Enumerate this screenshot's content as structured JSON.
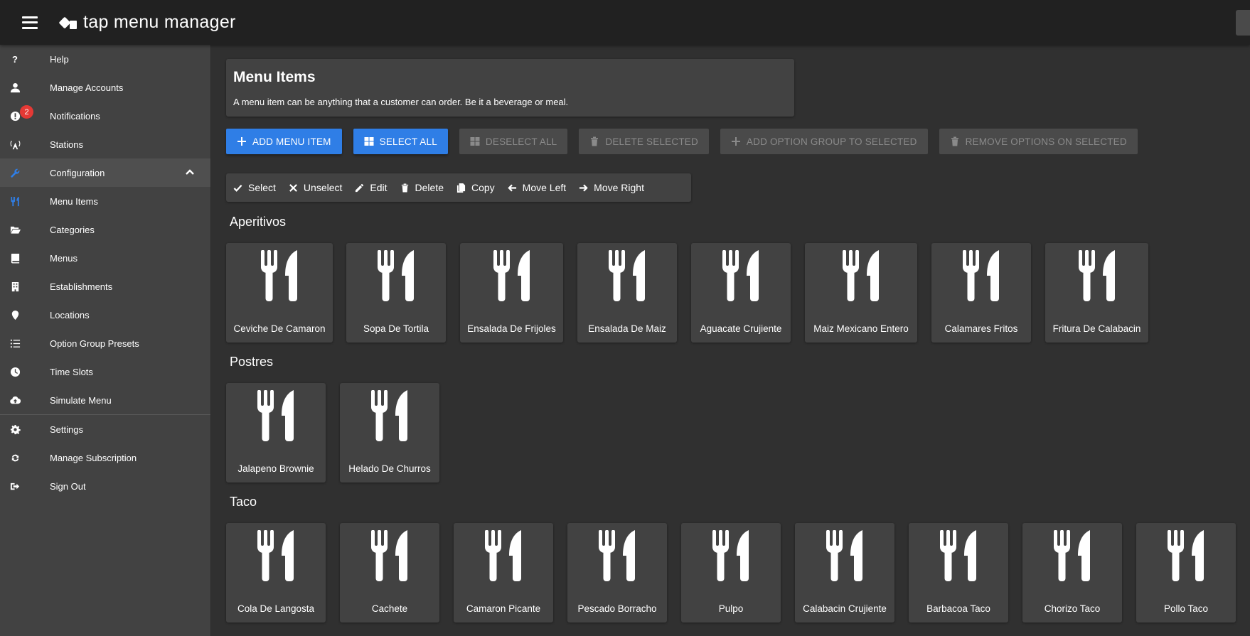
{
  "app": {
    "title": "tap menu manager"
  },
  "sidebar": {
    "notifications_badge": "2",
    "items": [
      {
        "label": "Help",
        "icon": "help-icon"
      },
      {
        "label": "Manage Accounts",
        "icon": "person-icon"
      },
      {
        "label": "Notifications",
        "icon": "alert-icon"
      },
      {
        "label": "Stations",
        "icon": "antenna-icon"
      },
      {
        "label": "Configuration",
        "icon": "wrench-icon"
      },
      {
        "label": "Menu Items",
        "icon": "utensils-icon"
      },
      {
        "label": "Categories",
        "icon": "folder-open-icon"
      },
      {
        "label": "Menus",
        "icon": "book-icon"
      },
      {
        "label": "Establishments",
        "icon": "building-icon"
      },
      {
        "label": "Locations",
        "icon": "map-marker-icon"
      },
      {
        "label": "Option Group Presets",
        "icon": "list-icon"
      },
      {
        "label": "Time Slots",
        "icon": "clock-icon"
      },
      {
        "label": "Simulate Menu",
        "icon": "cloud-upload-icon"
      },
      {
        "label": "Settings",
        "icon": "gear-icon"
      },
      {
        "label": "Manage Subscription",
        "icon": "sync-icon"
      },
      {
        "label": "Sign Out",
        "icon": "sign-out-icon"
      }
    ]
  },
  "header": {
    "title": "Menu Items",
    "description": "A menu item can be anything that a customer can order. Be it a beverage or meal."
  },
  "actions": {
    "add": "ADD MENU ITEM",
    "select_all": "SELECT ALL",
    "deselect_all": "DESELECT ALL",
    "delete_selected": "DELETE SELECTED",
    "add_option_group": "ADD OPTION GROUP TO SELECTED",
    "remove_options": "REMOVE OPTIONS ON SELECTED"
  },
  "toolbar": {
    "select": "Select",
    "unselect": "Unselect",
    "edit": "Edit",
    "delete": "Delete",
    "copy": "Copy",
    "move_left": "Move Left",
    "move_right": "Move Right"
  },
  "categories": [
    {
      "name": "Aperitivos",
      "items": [
        "Ceviche De Camaron",
        "Sopa De Tortila",
        "Ensalada De Frijoles",
        "Ensalada De Maiz",
        "Aguacate Crujiente",
        "Maiz Mexicano Entero",
        "Calamares Fritos",
        "Fritura De Calabacin"
      ]
    },
    {
      "name": "Postres",
      "items": [
        "Jalapeno Brownie",
        "Helado De Churros"
      ]
    },
    {
      "name": "Taco",
      "items": [
        "Cola De Langosta",
        "Cachete",
        "Camaron Picante",
        "Pescado Borracho",
        "Pulpo",
        "Calabacin Crujiente",
        "Barbacoa Taco",
        "Chorizo Taco",
        "Pollo Taco"
      ]
    }
  ],
  "colors": {
    "accent": "#2f7ee6",
    "badge": "#e53935",
    "background": "#303030",
    "surface": "#424242",
    "appbar": "#212121"
  }
}
